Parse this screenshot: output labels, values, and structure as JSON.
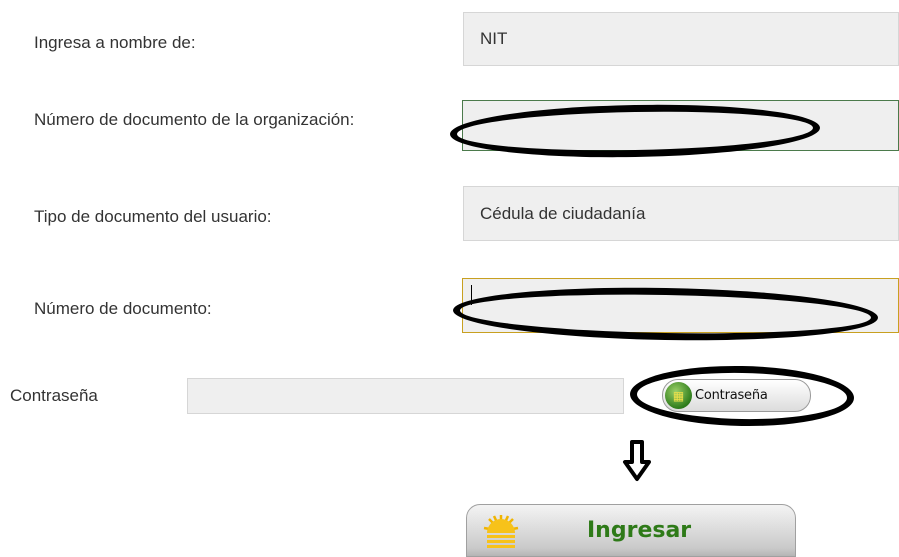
{
  "form": {
    "rows": [
      {
        "label": "Ingresa a nombre de:",
        "value": "NIT"
      },
      {
        "label": "Número de documento de la organización:",
        "value": ""
      },
      {
        "label": "Tipo de documento del usuario:",
        "value": "Cédula de ciudadanía"
      },
      {
        "label": "Número de documento:",
        "value": ""
      }
    ],
    "password": {
      "label": "Contraseña",
      "value": "",
      "button_label": "Contraseña"
    },
    "submit_label": "Ingresar"
  },
  "icons": {
    "password_button_icon": "keyboard-grid-icon",
    "submit_icon": "sun-icon",
    "annotation_arrow": "down-arrow-icon"
  },
  "colors": {
    "submit_text": "#2e7a18",
    "field_bg": "#efefef",
    "annotation": "#000000"
  }
}
